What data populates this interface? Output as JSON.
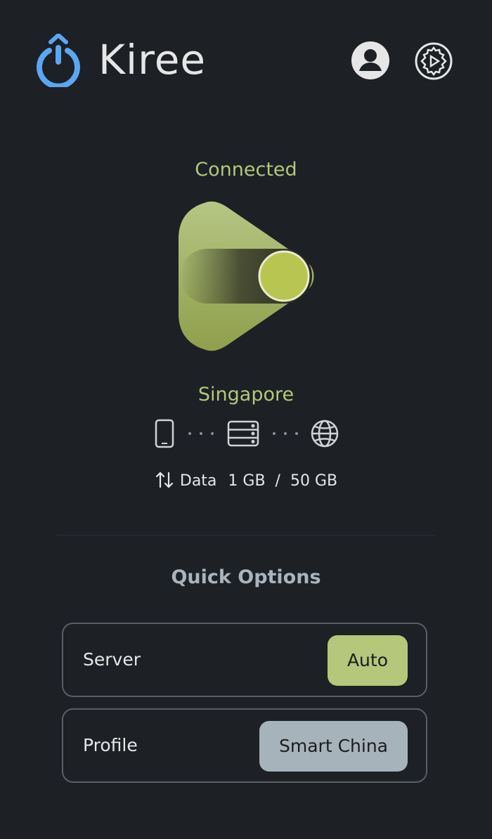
{
  "app": {
    "title": "Kiree"
  },
  "header": {
    "icons": [
      "power-icon",
      "account-icon",
      "settings-icon"
    ]
  },
  "connection": {
    "status": "Connected",
    "location": "Singapore",
    "route_icons": [
      "phone-icon",
      "server-icon",
      "globe-icon"
    ],
    "data_label": "Data",
    "data_used": "1 GB",
    "separator": "/",
    "data_total": "50 GB"
  },
  "quick_options": {
    "title": "Quick Options",
    "server": {
      "label": "Server",
      "value": "Auto"
    },
    "profile": {
      "label": "Profile",
      "value": "Smart China"
    }
  },
  "colors": {
    "background": "#1d2025",
    "accent_green": "#b4c77a",
    "brand_blue": "#5aa7f2",
    "profile_chip": "#a7b3bb"
  }
}
